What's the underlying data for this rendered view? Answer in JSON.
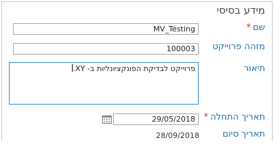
{
  "section": {
    "title": "מידע בסיסי"
  },
  "fields": {
    "name": {
      "label": "שם",
      "required_mark": "*",
      "value": "MV_Testing"
    },
    "project_id": {
      "label": "מזהה פרוייקט",
      "value": "100003"
    },
    "description": {
      "label": "תיאור",
      "value": "פרוייקט לבדיקת הפונקציונליות ב- XY."
    },
    "start_date": {
      "label": "תאריך התחלה",
      "required_mark": "*",
      "value": "29/05/2018",
      "icon": "calendar-icon"
    },
    "end_date": {
      "label": "תאריך סיום",
      "value": "28/09/2018"
    }
  }
}
